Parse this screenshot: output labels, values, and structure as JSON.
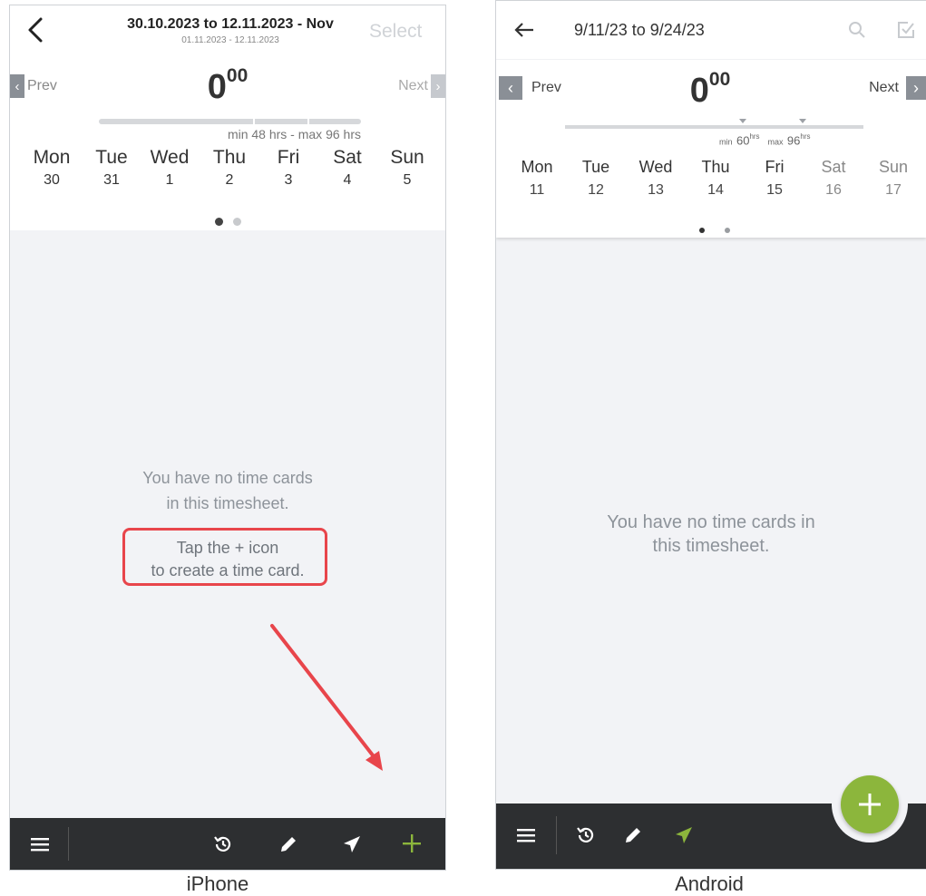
{
  "iphone": {
    "header": {
      "title": "30.10.2023 to 12.11.2023 - Nov",
      "subtitle": "01.11.2023 - 12.11.2023",
      "select_label": "Select"
    },
    "summary": {
      "prev_label": "Prev",
      "next_label": "Next",
      "hours_main": "0",
      "hours_minutes": "00",
      "range_label": "min 48 hrs - max 96 hrs"
    },
    "days": [
      {
        "name": "Mon",
        "date": "30"
      },
      {
        "name": "Tue",
        "date": "31"
      },
      {
        "name": "Wed",
        "date": "1"
      },
      {
        "name": "Thu",
        "date": "2"
      },
      {
        "name": "Fri",
        "date": "3"
      },
      {
        "name": "Sat",
        "date": "4"
      },
      {
        "name": "Sun",
        "date": "5"
      }
    ],
    "empty_line1": "You have no time cards",
    "empty_line2": "in this timesheet.",
    "hint_line1": "Tap the + icon",
    "hint_line2": "to create a time card.",
    "bottom_bar": {
      "menu_icon": "menu-icon",
      "history_icon": "history-icon",
      "edit_icon": "pencil-icon",
      "submit_icon": "send-icon",
      "add_icon": "plus-icon"
    },
    "caption": "iPhone"
  },
  "android": {
    "header": {
      "title": "9/11/23 to 9/24/23"
    },
    "summary": {
      "prev_label": "Prev",
      "next_label": "Next",
      "hours_main": "0",
      "hours_minutes": "00",
      "min_prefix": "min",
      "min_value": "60",
      "max_prefix": "max",
      "max_value": "96",
      "unit": "hrs"
    },
    "days": [
      {
        "name": "Mon",
        "date": "11"
      },
      {
        "name": "Tue",
        "date": "12"
      },
      {
        "name": "Wed",
        "date": "13"
      },
      {
        "name": "Thu",
        "date": "14"
      },
      {
        "name": "Fri",
        "date": "15"
      },
      {
        "name": "Sat",
        "date": "16"
      },
      {
        "name": "Sun",
        "date": "17"
      }
    ],
    "empty_line1": "You have no time cards in",
    "empty_line2": "this timesheet.",
    "bottom_bar": {
      "menu_icon": "menu-icon",
      "history_icon": "history-icon",
      "edit_icon": "pencil-icon",
      "submit_icon": "send-icon",
      "fab_icon": "plus-icon"
    },
    "caption": "Android"
  },
  "colors": {
    "accent_green": "#8cb63c",
    "annotation_red": "#e8454b",
    "bar_dark": "#2d2f31",
    "muted_text": "#8d939a"
  }
}
